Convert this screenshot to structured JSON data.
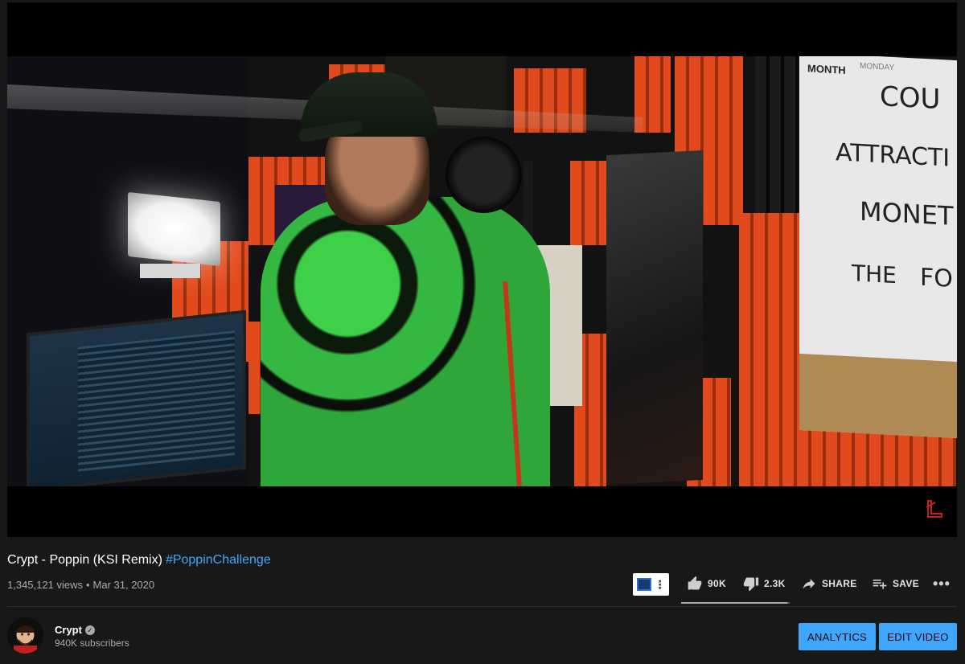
{
  "video": {
    "title": "Crypt - Poppin (KSI Remix)",
    "hashtag": "#PoppinChallenge",
    "views": "1,345,121 views",
    "separator": "•",
    "date": "Mar 31, 2020",
    "scene_board_words": [
      "MONTH",
      "MONDAY",
      "COU",
      "ATTRACTI",
      "MONET",
      "THE",
      "FO"
    ]
  },
  "actions": {
    "likes": "90K",
    "dislikes": "2.3K",
    "share_label": "SHARE",
    "save_label": "SAVE",
    "more_label": "•••",
    "like_ratio": 0.975
  },
  "channel": {
    "name": "Crypt",
    "verified_mark": "✓",
    "subscribers": "940K subscribers"
  },
  "buttons": {
    "analytics": "ANALYTICS",
    "edit_video": "EDIT VIDEO"
  },
  "colors": {
    "accent": "#3ea6ff",
    "background": "#181818",
    "secondary_text": "#aaaaaa"
  }
}
